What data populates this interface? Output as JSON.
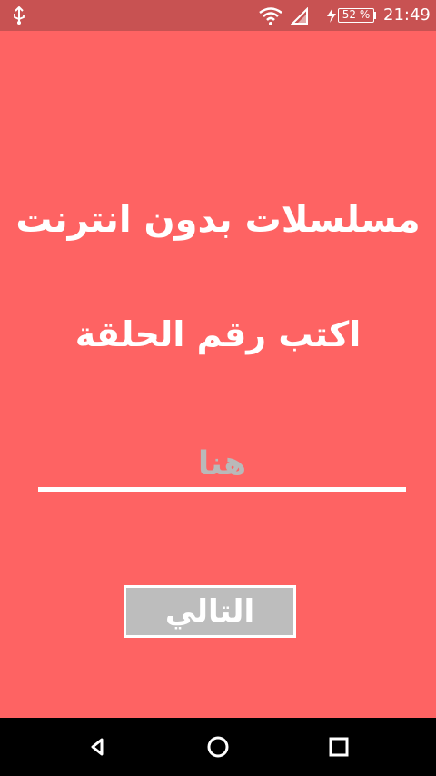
{
  "status_bar": {
    "battery_level": "52 %",
    "time": "21:49",
    "icons": [
      "usb-icon",
      "wifi-icon",
      "signal-icon",
      "charging-bolt-icon",
      "battery-icon"
    ]
  },
  "app": {
    "title": "مسلسلات بدون انترنت",
    "subtitle": "اكتب رقم الحلقة",
    "episode_input": {
      "value": "",
      "placeholder": "هنا"
    },
    "next_button_label": "التالي"
  },
  "colors": {
    "background": "#fe6363",
    "status_bar": "#c85252",
    "button": "#bdbdbd",
    "text": "#ffffff"
  },
  "navigation": {
    "icons": [
      "back-icon",
      "home-icon",
      "recent-apps-icon"
    ]
  }
}
